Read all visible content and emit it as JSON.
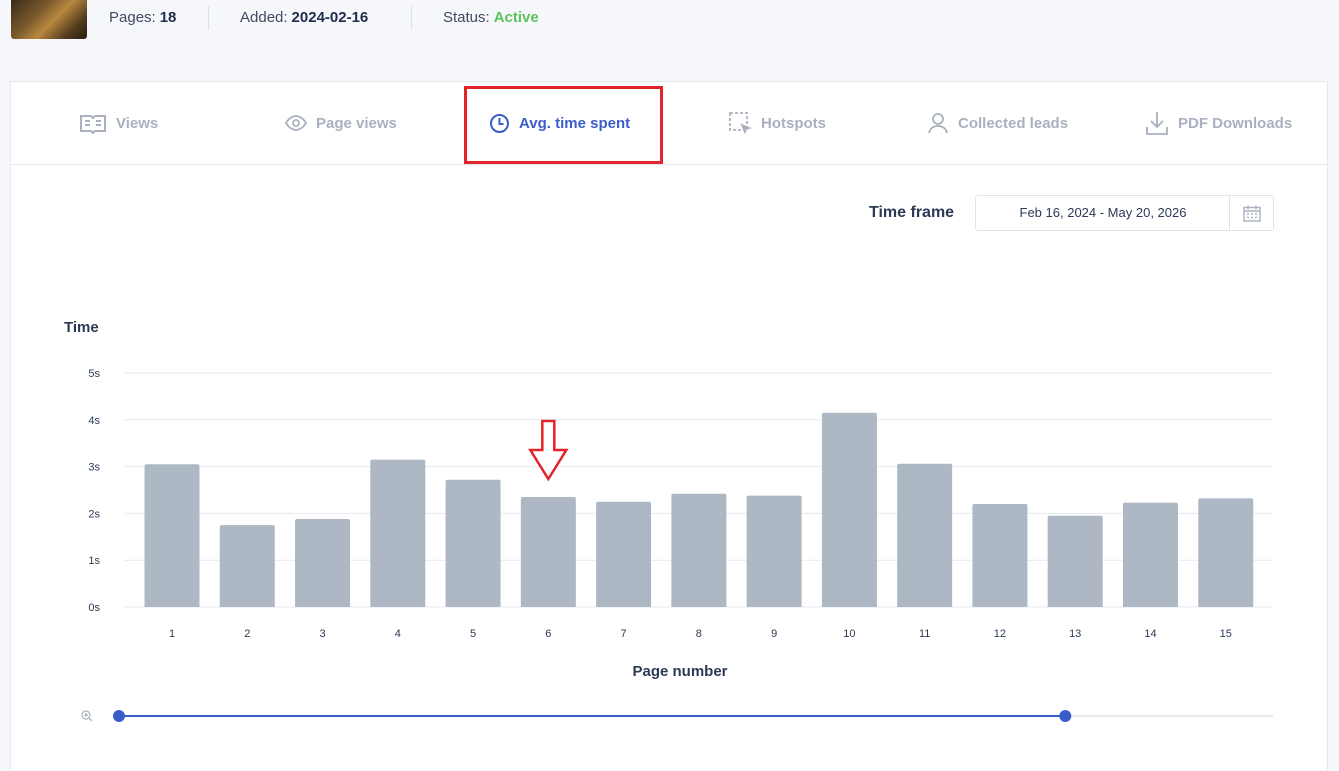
{
  "doc": {
    "pages_label": "Pages:",
    "pages_value": "18",
    "added_label": "Added:",
    "added_value": "2024-02-16",
    "status_label": "Status:",
    "status_value": "Active"
  },
  "tabs": [
    {
      "label": "Views",
      "icon": "book-icon",
      "active": false
    },
    {
      "label": "Page views",
      "icon": "eye-icon",
      "active": false
    },
    {
      "label": "Avg. time spent",
      "icon": "clock-icon",
      "active": true
    },
    {
      "label": "Hotspots",
      "icon": "hotspot-icon",
      "active": false
    },
    {
      "label": "Collected leads",
      "icon": "user-icon",
      "active": false
    },
    {
      "label": "PDF Downloads",
      "icon": "download-icon",
      "active": false
    }
  ],
  "timeframe": {
    "label": "Time frame",
    "value": "Feb 16, 2024 - May 20, 2026"
  },
  "colors": {
    "accent": "#3a5dc9",
    "bar": "#adb8c4",
    "highlight": "#e0242a",
    "status_active": "#5cc25e"
  },
  "chart_data": {
    "type": "bar",
    "ylabel": "Time",
    "xlabel": "Page number",
    "categories": [
      "1",
      "2",
      "3",
      "4",
      "5",
      "6",
      "7",
      "8",
      "9",
      "10",
      "11",
      "12",
      "13",
      "14",
      "15"
    ],
    "values": [
      3.05,
      1.75,
      1.88,
      3.15,
      2.72,
      2.35,
      2.25,
      2.42,
      2.38,
      4.15,
      3.06,
      2.2,
      1.95,
      2.23,
      2.32
    ],
    "ylim": [
      0,
      5
    ],
    "yticks": [
      "0s",
      "1s",
      "2s",
      "3s",
      "4s",
      "5s"
    ],
    "grid": true,
    "annotation": "down arrow above page 6"
  },
  "zoom": {
    "start": 0.0,
    "end": 0.82
  }
}
